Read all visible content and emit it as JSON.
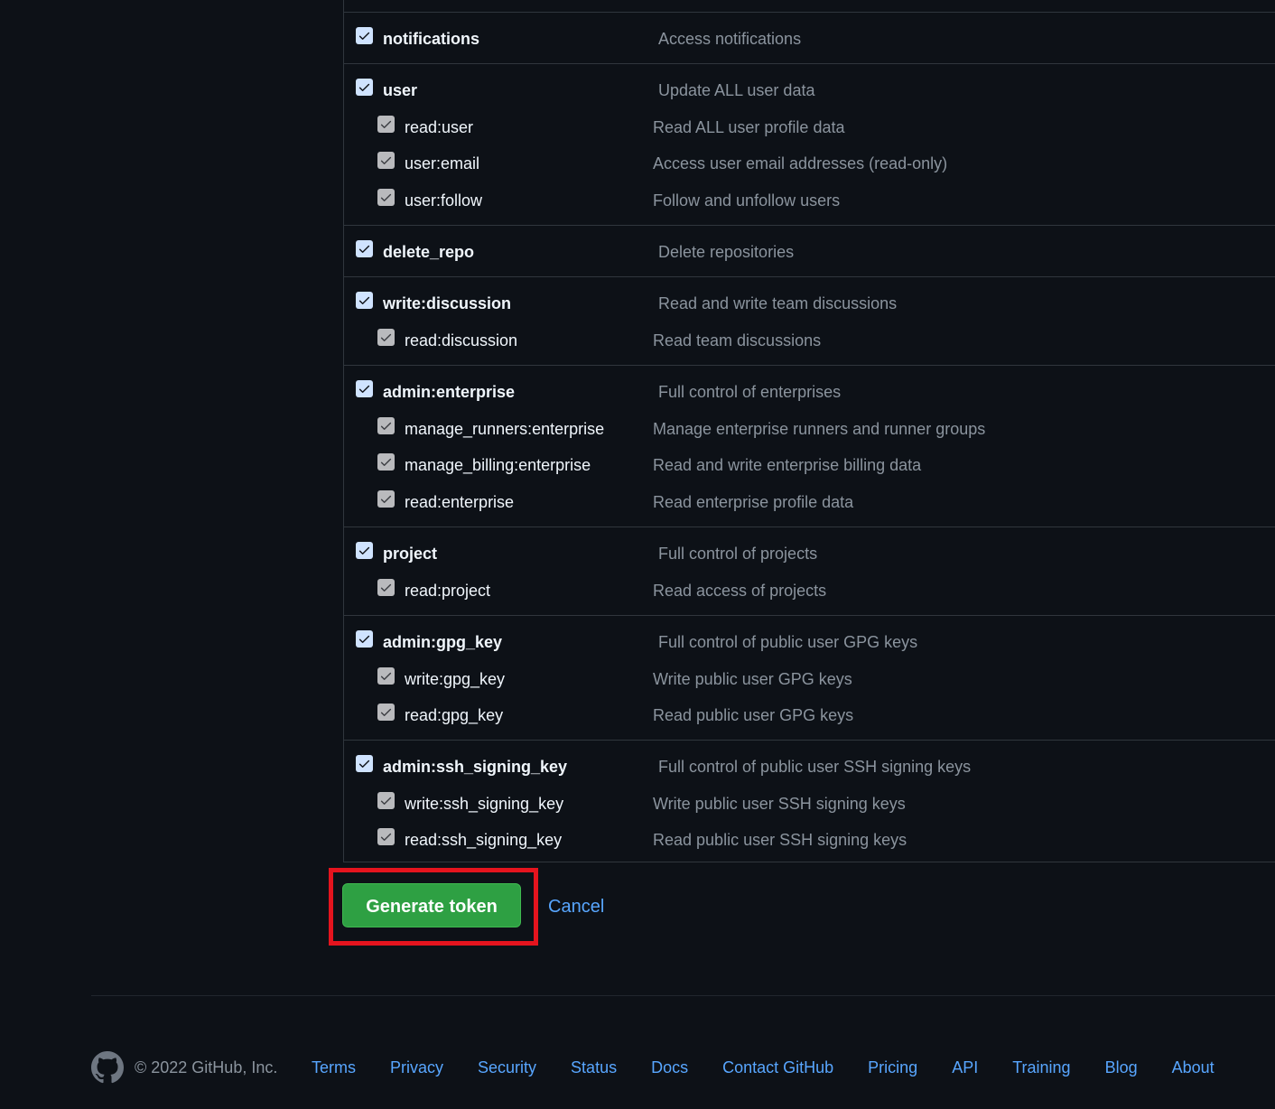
{
  "scopes": [
    {
      "name": "notifications",
      "desc": "Access notifications",
      "checked": true,
      "children": []
    },
    {
      "name": "user",
      "desc": "Update ALL user data",
      "checked": true,
      "children": [
        {
          "name": "read:user",
          "desc": "Read ALL user profile data",
          "checked": true
        },
        {
          "name": "user:email",
          "desc": "Access user email addresses (read-only)",
          "checked": true
        },
        {
          "name": "user:follow",
          "desc": "Follow and unfollow users",
          "checked": true
        }
      ]
    },
    {
      "name": "delete_repo",
      "desc": "Delete repositories",
      "checked": true,
      "children": []
    },
    {
      "name": "write:discussion",
      "desc": "Read and write team discussions",
      "checked": true,
      "children": [
        {
          "name": "read:discussion",
          "desc": "Read team discussions",
          "checked": true
        }
      ]
    },
    {
      "name": "admin:enterprise",
      "desc": "Full control of enterprises",
      "checked": true,
      "children": [
        {
          "name": "manage_runners:enterprise",
          "desc": "Manage enterprise runners and runner groups",
          "checked": true
        },
        {
          "name": "manage_billing:enterprise",
          "desc": "Read and write enterprise billing data",
          "checked": true
        },
        {
          "name": "read:enterprise",
          "desc": "Read enterprise profile data",
          "checked": true
        }
      ]
    },
    {
      "name": "project",
      "desc": "Full control of projects",
      "checked": true,
      "children": [
        {
          "name": "read:project",
          "desc": "Read access of projects",
          "checked": true
        }
      ]
    },
    {
      "name": "admin:gpg_key",
      "desc": "Full control of public user GPG keys",
      "checked": true,
      "children": [
        {
          "name": "write:gpg_key",
          "desc": "Write public user GPG keys",
          "checked": true
        },
        {
          "name": "read:gpg_key",
          "desc": "Read public user GPG keys",
          "checked": true
        }
      ]
    },
    {
      "name": "admin:ssh_signing_key",
      "desc": "Full control of public user SSH signing keys",
      "checked": true,
      "children": [
        {
          "name": "write:ssh_signing_key",
          "desc": "Write public user SSH signing keys",
          "checked": true
        },
        {
          "name": "read:ssh_signing_key",
          "desc": "Read public user SSH signing keys",
          "checked": true
        }
      ]
    }
  ],
  "actions": {
    "generate_label": "Generate token",
    "cancel_label": "Cancel"
  },
  "footer": {
    "logo_icon": "github-mark-icon",
    "copyright": "© 2022 GitHub, Inc.",
    "links": [
      "Terms",
      "Privacy",
      "Security",
      "Status",
      "Docs",
      "Contact GitHub",
      "Pricing",
      "API",
      "Training",
      "Blog",
      "About"
    ]
  },
  "colors": {
    "background": "#0d1117",
    "primary_button": "#2ea043",
    "link": "#58a6ff",
    "highlight_box": "#e5141e"
  }
}
